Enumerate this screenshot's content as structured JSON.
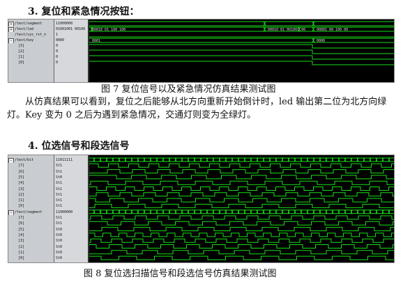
{
  "section3": {
    "heading": "3. 复位和紧急情况按钮：",
    "panel": {
      "signals": [
        {
          "name": "/test/segment",
          "value": "11000000"
        },
        {
          "name": "/test/led",
          "value": "01001001 00100"
        },
        {
          "name": "/test/sys_rst_n",
          "value": "1"
        },
        {
          "name": "/test/key",
          "value": "0000"
        },
        {
          "name": "[3]",
          "value": "0"
        },
        {
          "name": "[2]",
          "value": "0"
        },
        {
          "name": "[1]",
          "value": "0"
        },
        {
          "name": "[0]",
          "value": "0"
        }
      ],
      "bus_labels": [
        "00010 01 100 100",
        "00010 01 001001 00",
        "00001 00 100 00",
        "0001",
        "0000"
      ]
    },
    "caption": "图 7  复位信号以及紧急情况仿真结果测试图",
    "paragraph": "从仿真结果可以看到，复位之后能够从北方向重新开始倒计时，led 输出第二位为北方向绿灯。Key 变为 0 之后为遇到紧急情况，交通灯则变为全绿灯。"
  },
  "section4": {
    "heading": "4. 位选信号和段选信号",
    "panel": {
      "signals": [
        {
          "name": "/test/bit",
          "value": "11011111"
        },
        {
          "name": "[7]",
          "value": "St1"
        },
        {
          "name": "[6]",
          "value": "St1"
        },
        {
          "name": "[5]",
          "value": "St0"
        },
        {
          "name": "[4]",
          "value": "St1"
        },
        {
          "name": "[3]",
          "value": "St1"
        },
        {
          "name": "[2]",
          "value": "St1"
        },
        {
          "name": "[1]",
          "value": "St1"
        },
        {
          "name": "[0]",
          "value": "St1"
        },
        {
          "name": "/test/segment",
          "value": "11000000"
        },
        {
          "name": "[7]",
          "value": "St1"
        },
        {
          "name": "[6]",
          "value": "St1"
        },
        {
          "name": "[5]",
          "value": "St0"
        },
        {
          "name": "[4]",
          "value": "St0"
        },
        {
          "name": "[3]",
          "value": "St0"
        },
        {
          "name": "[2]",
          "value": "St0"
        },
        {
          "name": "[1]",
          "value": "St0"
        },
        {
          "name": "[0]",
          "value": "St0"
        }
      ]
    },
    "caption": "图 8  复位选扫描信号和段选信号仿真结果测试图"
  },
  "colors": {
    "wave_green": "#19e019",
    "wave_bg": "#000000",
    "names_bg": "#c9ccd0",
    "vals_bg": "#d6d8dc"
  }
}
